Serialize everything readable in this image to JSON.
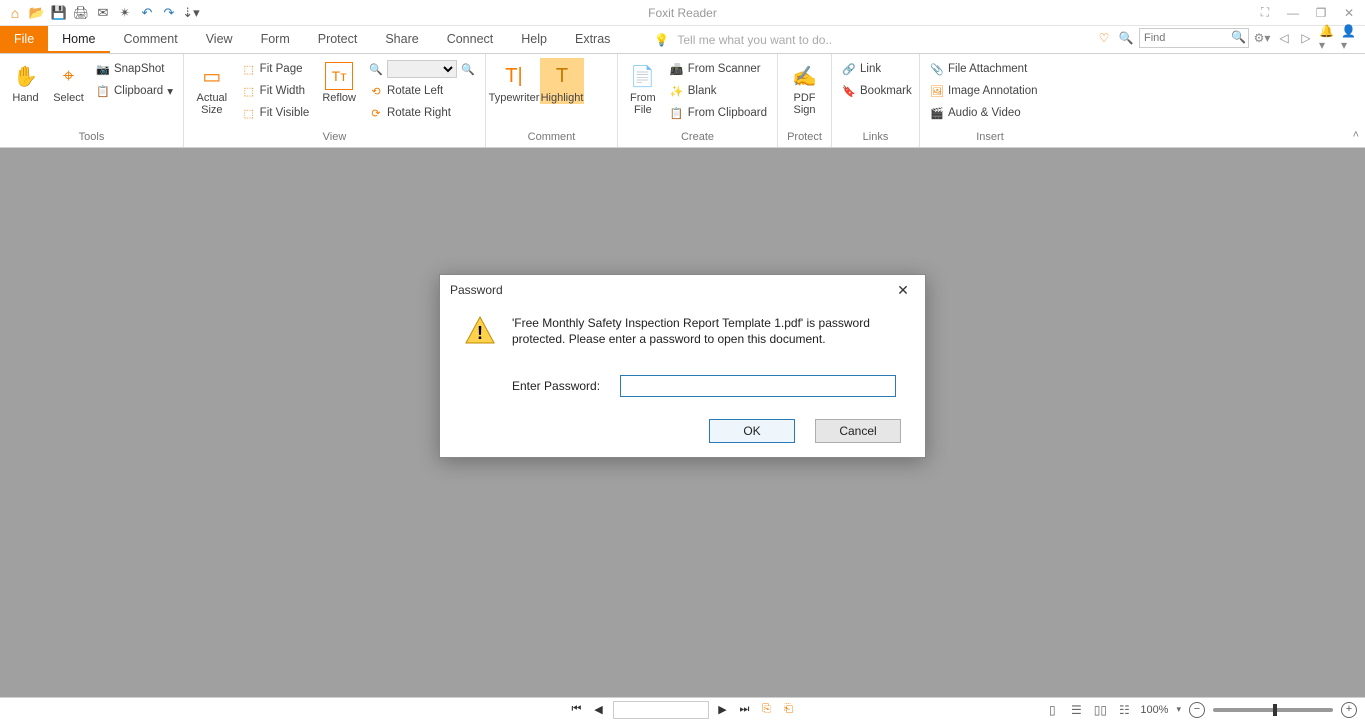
{
  "app": {
    "title": "Foxit Reader"
  },
  "tabs": {
    "file": "File",
    "home": "Home",
    "comment": "Comment",
    "view": "View",
    "form": "Form",
    "protect": "Protect",
    "share": "Share",
    "connect": "Connect",
    "help": "Help",
    "extras": "Extras"
  },
  "tellme": "Tell me what you want to do..",
  "search": {
    "placeholder": "Find"
  },
  "ribbon": {
    "tools": {
      "hand": "Hand",
      "select": "Select",
      "snapshot": "SnapShot",
      "clipboard": "Clipboard",
      "label": "Tools"
    },
    "view": {
      "actual": "Actual Size",
      "fitpage": "Fit Page",
      "fitwidth": "Fit Width",
      "fitvisible": "Fit Visible",
      "reflow": "Reflow",
      "rotl": "Rotate Left",
      "rotr": "Rotate Right",
      "label": "View"
    },
    "comment": {
      "type": "Typewriter",
      "highlight": "Highlight",
      "label": "Comment"
    },
    "create": {
      "fromfile": "From File",
      "scanner": "From Scanner",
      "blank": "Blank",
      "clip": "From Clipboard",
      "label": "Create"
    },
    "protect": {
      "pdfsign": "PDF Sign",
      "label": "Protect"
    },
    "links": {
      "link": "Link",
      "bookmark": "Bookmark",
      "label": "Links"
    },
    "insert": {
      "attach": "File Attachment",
      "imganno": "Image Annotation",
      "av": "Audio & Video",
      "label": "Insert"
    }
  },
  "dialog": {
    "title": "Password",
    "message": "'Free Monthly Safety Inspection Report Template 1.pdf' is password protected. Please enter a password to open this document.",
    "enter": "Enter Password:",
    "ok": "OK",
    "cancel": "Cancel"
  },
  "status": {
    "zoom": "100%"
  }
}
